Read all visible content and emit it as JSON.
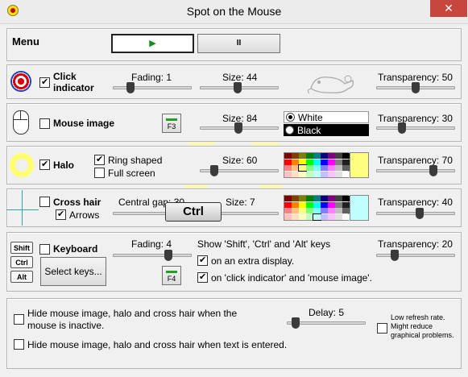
{
  "window": {
    "title": "Spot on the Mouse",
    "close_glyph": "✕"
  },
  "menu": {
    "label": "Menu",
    "play_glyph": "▶",
    "pause_glyph": "II"
  },
  "click_indicator": {
    "label_line1": "Click",
    "label_line2": "indicator",
    "checked": true,
    "fading": "Fading: 1",
    "size": "Size: 44",
    "transparency": "Transparency: 50"
  },
  "mouse_image": {
    "label": "Mouse image",
    "checked": false,
    "hotkey": "F3",
    "size": "Size: 84",
    "color_white": "White",
    "color_black": "Black",
    "selected_color": "White",
    "transparency": "Transparency: 30"
  },
  "halo": {
    "label": "Halo",
    "checked": true,
    "ring_shaped": "Ring shaped",
    "ring_checked": true,
    "full_screen": "Full screen",
    "full_checked": false,
    "size": "Size: 60",
    "color": "#ffff80",
    "transparency": "Transparency: 70"
  },
  "cross_hair": {
    "label": "Cross hair",
    "checked": false,
    "arrows": "Arrows",
    "arrows_checked": true,
    "central_gap": "Central gap: 30",
    "size": "Size: 7",
    "color": "#c0ffff",
    "transparency": "Transparency: 40"
  },
  "overlay_key": "Ctrl",
  "keyboard": {
    "keys": [
      "Shift",
      "Ctrl",
      "Alt"
    ],
    "label": "Keyboard",
    "checked": false,
    "fading": "Fading: 4",
    "select_keys": "Select keys...",
    "hotkey": "F4",
    "show_text": "Show 'Shift', 'Ctrl' and 'Alt' keys",
    "extra_display": "on an extra display.",
    "extra_checked": true,
    "on_click": "on 'click indicator' and 'mouse image'.",
    "on_click_checked": true,
    "transparency": "Transparency: 20"
  },
  "options": {
    "hide_inactive": "Hide mouse image, halo and cross hair when the mouse is inactive.",
    "hide_inactive_checked": false,
    "delay": "Delay: 5",
    "hide_text": "Hide mouse image, halo and cross hair when text is entered.",
    "hide_text_checked": false,
    "low_refresh": "Low refresh rate. Might reduce graphical problems.",
    "low_refresh_checked": false
  },
  "colors": {
    "close": "#c7463d",
    "halo_glow": "#ffffa0",
    "cross": "#2aa8a8"
  }
}
